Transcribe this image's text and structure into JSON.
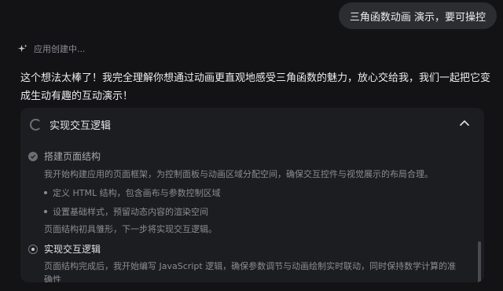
{
  "user_message": "三角函数动画 演示，要可操控",
  "status": {
    "text": "应用创建中..."
  },
  "reply": {
    "line1": "这个想法太棒了！我完全理解你想通过动画更直观地感受三角函数的魅力，放心交给我，我们一起把它变",
    "line2": "成生动有趣的互动演示！"
  },
  "task_card": {
    "title": "实现交互逻辑",
    "steps": [
      {
        "label": "搭建页面结构",
        "status": "done",
        "description": "我开始构建应用的页面框架，为控制面板与动画区域分配空间，确保交互控件与视觉展示的布局合理。",
        "bullets": [
          "定义 HTML 结构，包含画布与参数控制区域",
          "设置基础样式，预留动态内容的渲染空间"
        ],
        "footer": "页面结构初具雏形，下一步将实现交互逻辑。"
      },
      {
        "label": "实现交互逻辑",
        "status": "in-progress",
        "description_line1": "页面结构完成后，我开始编写 JavaScript 逻辑，确保参数调节与动画绘制实时联动，同时保持数学计算的准",
        "description_line2": "确性"
      }
    ]
  }
}
